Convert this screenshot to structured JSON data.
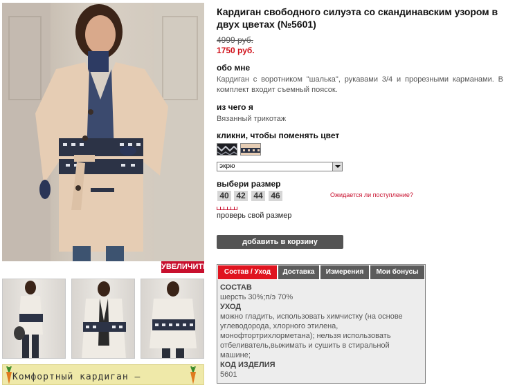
{
  "product": {
    "title": "Кардиган свободного силуэта со скандинавским узором в двух цветах (№5601)",
    "old_price": "4999 руб.",
    "new_price": "1750 руб."
  },
  "gallery": {
    "zoom_label": "УВЕЛИЧИТЬ",
    "promo_text": "Комфортный кардиган –"
  },
  "about": {
    "heading": "обо мне",
    "text": "Кардиган с воротником \"шалька\", рукавами 3/4 и прорезными карманами. В комплект входит съемный поясок."
  },
  "material": {
    "heading": "из чего я",
    "text": "Вязанный трикотаж"
  },
  "color": {
    "heading": "кликни, чтобы поменять цвет",
    "selected": "экрю"
  },
  "size": {
    "heading": "выбери размер",
    "options": [
      "40",
      "42",
      "44",
      "46"
    ],
    "notify_link": "Ожидается ли поступление?",
    "check_link": "проверь свой размер"
  },
  "cart": {
    "button_label": "добавить в корзину"
  },
  "tabs": {
    "items": [
      {
        "label": "Состав / Уход",
        "active": true
      },
      {
        "label": "Доставка",
        "active": false
      },
      {
        "label": "Измерения",
        "active": false
      },
      {
        "label": "Мои бонусы",
        "active": false
      }
    ],
    "content": {
      "composition_heading": "СОСТАВ",
      "composition_text": "шерсть 30%;п/э 70%",
      "care_heading": "УХОД",
      "care_text": "можно гладить, использовать химчистку (на основе углеводорода, хлорного этилена, монофтортрихлорметана); нельзя использовать отбеливатель,выжимать и сушить в стиральной машине;",
      "code_heading": "КОД ИЗДЕЛИЯ",
      "code_value": "5601"
    }
  },
  "colors": {
    "accent_red": "#e0141f",
    "price_red": "#d0121b",
    "dark_button": "#545454",
    "cardigan_beige": "#e6cdb4",
    "cardigan_white": "#efebe4",
    "navy_pattern": "#2c3346"
  }
}
